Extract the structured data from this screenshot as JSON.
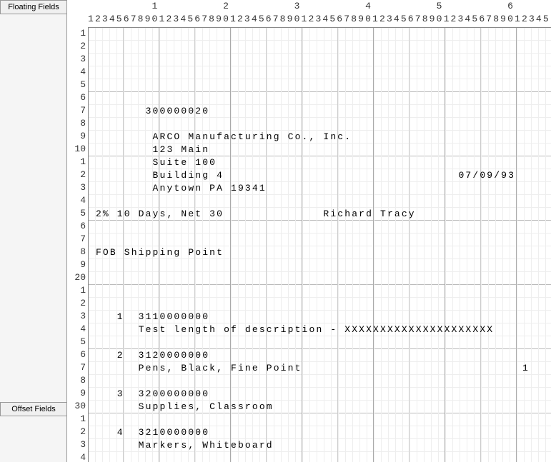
{
  "sidebar": {
    "floating_label": "Floating Fields",
    "offset_label": "Offset Fields"
  },
  "ruler": {
    "tens": "         1         2         3         4         5         6        ",
    "ones": "12345678901234567890123456789012345678901234567890123456789012345"
  },
  "row_labels": [
    "1",
    "2",
    "3",
    "4",
    "5",
    "6",
    "7",
    "8",
    "9",
    "10",
    "1",
    "2",
    "3",
    "4",
    "5",
    "6",
    "7",
    "8",
    "9",
    "20",
    "1",
    "2",
    "3",
    "4",
    "5",
    "6",
    "7",
    "8",
    "9",
    "30",
    "1",
    "2",
    "3",
    "4"
  ],
  "lines": {
    "l7": "        300000020",
    "l9": "         ARCO Manufacturing Co., Inc.",
    "l10": "         123 Main",
    "l11": "         Suite 100",
    "l12": "         Building 4                                 07/09/93",
    "l13": "         Anytown PA 19341",
    "l15": " 2% 10 Days, Net 30              Richard Tracy",
    "l18": " FOB Shipping Point",
    "l23": "    1  3110000000",
    "l24": "       Test length of description - XXXXXXXXXXXXXXXXXXXXX",
    "l26": "    2  3120000000",
    "l27": "       Pens, Black, Fine Point                               1",
    "l29": "    3  3200000000",
    "l30": "       Supplies, Classroom",
    "l32": "    4  3210000000",
    "l33": "       Markers, Whiteboard"
  }
}
